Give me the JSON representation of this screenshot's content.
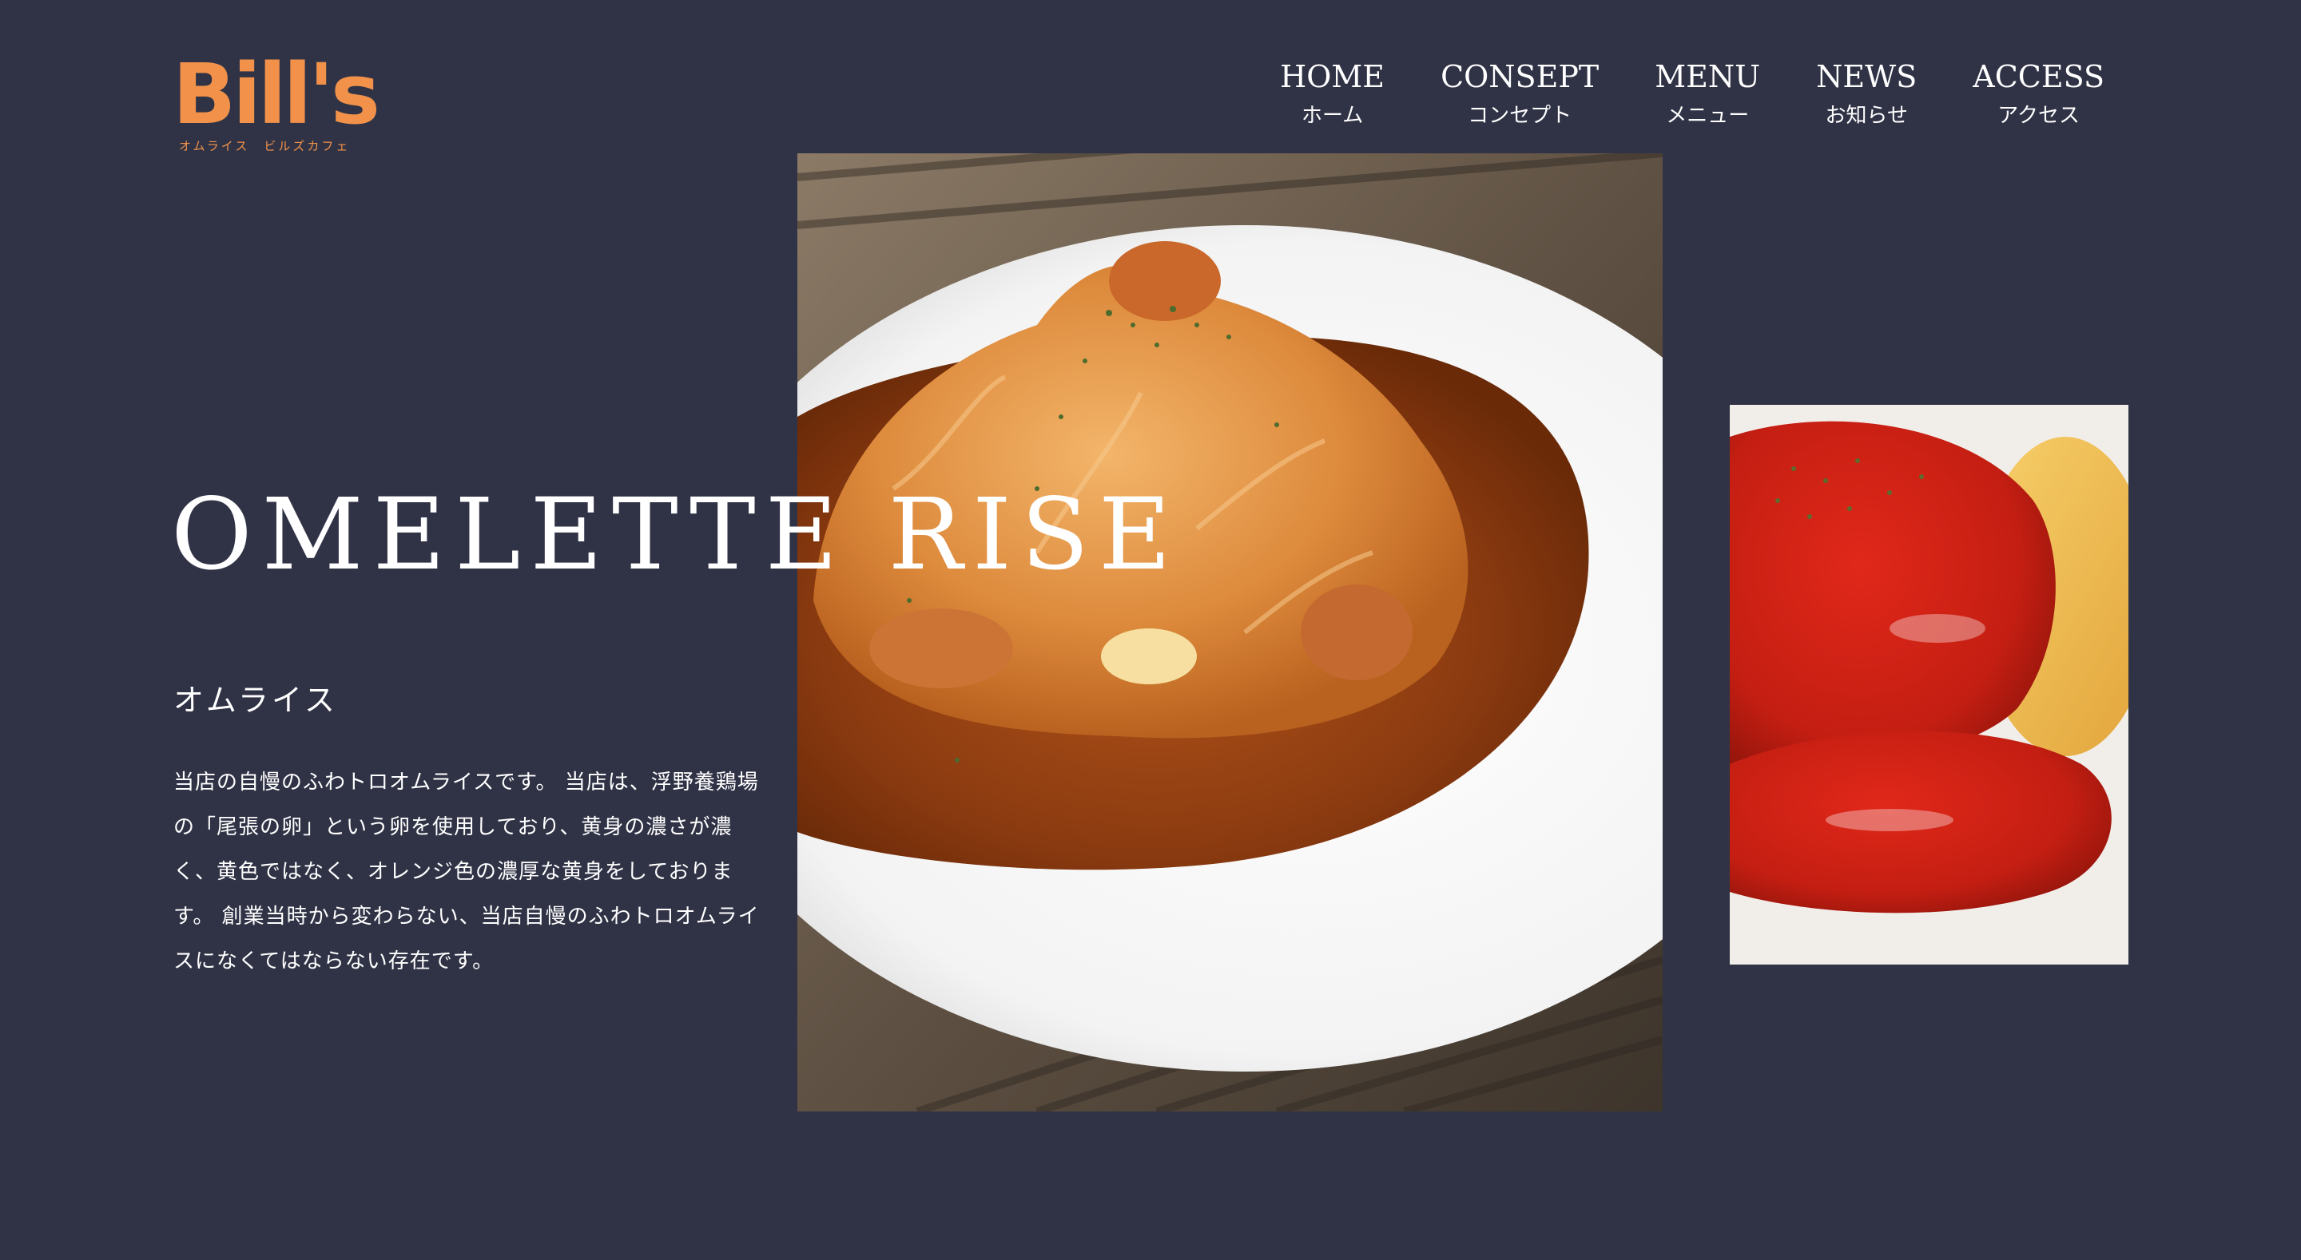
{
  "brand": {
    "logo_text": "Bill's",
    "logo_sub": "オムライス　ビルズカフェ",
    "accent_color": "#f2924a"
  },
  "nav": [
    {
      "en": "HOME",
      "ja": "ホーム"
    },
    {
      "en": "CONSEPT",
      "ja": "コンセプト"
    },
    {
      "en": "MENU",
      "ja": "メニュー"
    },
    {
      "en": "NEWS",
      "ja": "お知らせ"
    },
    {
      "en": "ACCESS",
      "ja": "アクセス"
    }
  ],
  "hero": {
    "title": "OMELETTE RISE",
    "subtitle": "オムライス",
    "description": "当店の自慢のふわトロオムライスです。 当店は、浮野養鶏場の「尾張の卵」という卵を使用しており、黄身の濃さが濃く、黄色ではなく、オレンジ色の濃厚な黄身をしております。 創業当時から変わらない、当店自慢のふわトロオムライスになくてはならない存在です。"
  },
  "colors": {
    "background": "#303346",
    "text": "#ffffff"
  }
}
